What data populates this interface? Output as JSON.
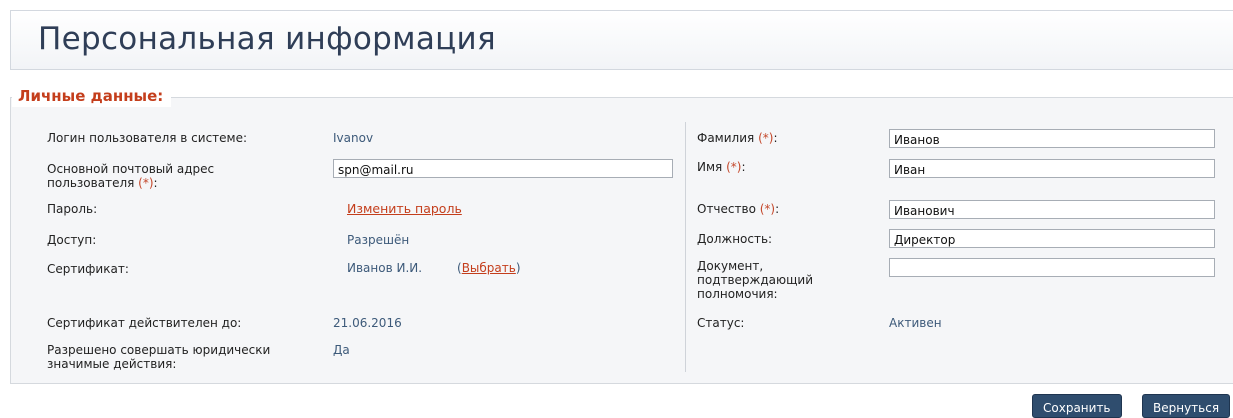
{
  "page_title": "Персональная информация",
  "section_title": "Личные данные:",
  "required_mark": "(*)",
  "left": {
    "login_label": "Логин пользователя в системе:",
    "login_value": "Ivanov",
    "email_label_1": "Основной почтовый адрес",
    "email_label_2": "пользователя",
    "email_value": "spn@mail.ru",
    "password_label": "Пароль:",
    "password_link": "Изменить пароль",
    "access_label": "Доступ:",
    "access_value": "Разрешён",
    "cert_label": "Сертификат:",
    "cert_value": "Иванов И.И.",
    "cert_choose_open": "(",
    "cert_choose_link": "Выбрать",
    "cert_choose_close": ")",
    "cert_valid_label": "Сертификат действителен до:",
    "cert_valid_value": "21.06.2016",
    "legal_label_1": "Разрешено совершать юридически",
    "legal_label_2": "значимые действия:",
    "legal_value": "Да"
  },
  "right": {
    "surname_label": "Фамилия",
    "surname_value": "Иванов",
    "name_label": "Имя",
    "name_value": "Иван",
    "patronymic_label": "Отчество",
    "patronymic_value": "Иванович",
    "position_label": "Должность:",
    "position_value": "Директор",
    "document_label_1": "Документ,",
    "document_label_2": "подтверждающий",
    "document_label_3": "полномочия:",
    "document_value": "",
    "status_label": "Статус:",
    "status_value": "Активен"
  },
  "buttons": {
    "save": "Сохранить",
    "back": "Вернуться"
  },
  "colors": {
    "title": "#2f3e57",
    "section_title": "#c43e1c",
    "value_text": "#3d5a7a",
    "button_bg": "#2f4d6e"
  }
}
